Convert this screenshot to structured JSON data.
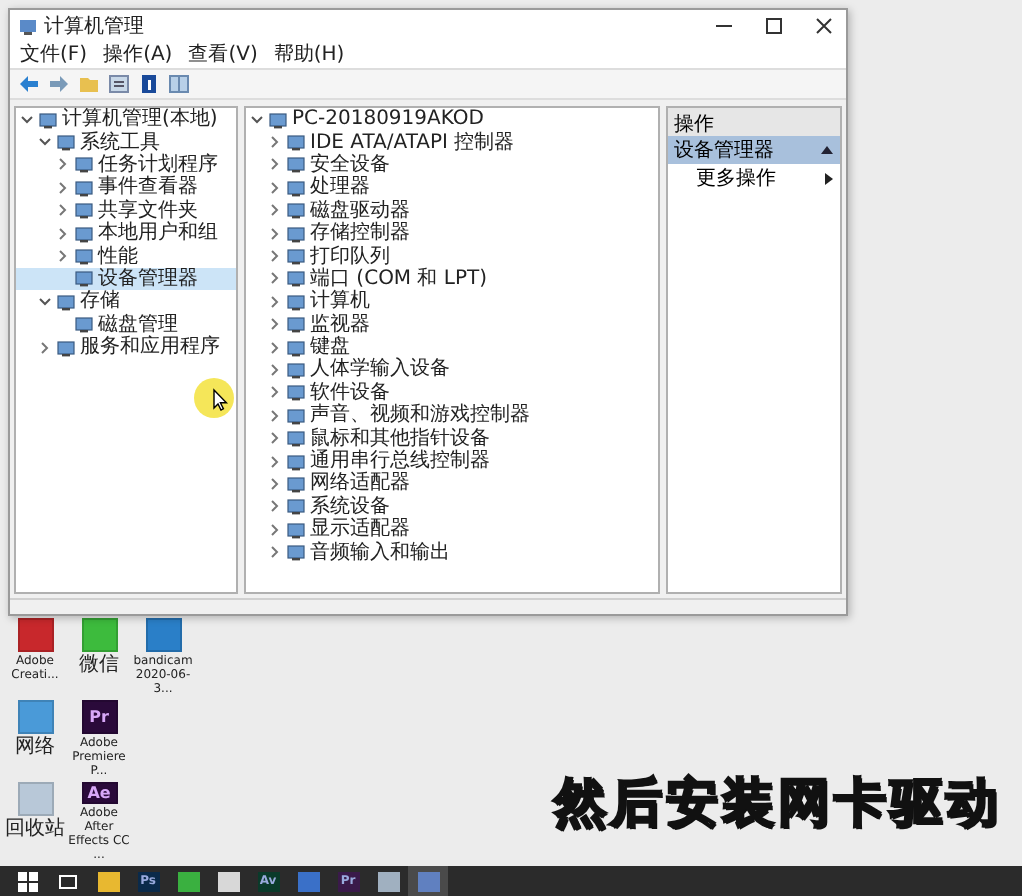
{
  "window": {
    "title": "计算机管理",
    "menu": [
      "文件(F)",
      "操作(A)",
      "查看(V)",
      "帮助(H)"
    ],
    "tree": [
      {
        "label": "计算机管理(本地)",
        "selected": false,
        "expanded": true,
        "children": [
          {
            "label": "系统工具",
            "selected": false,
            "expanded": true,
            "children": [
              {
                "label": "任务计划程序",
                "selected": false,
                "expanded": false
              },
              {
                "label": "事件查看器",
                "selected": false,
                "expanded": false
              },
              {
                "label": "共享文件夹",
                "selected": false,
                "expanded": false
              },
              {
                "label": "本地用户和组",
                "selected": false,
                "expanded": false
              },
              {
                "label": "性能",
                "selected": false,
                "expanded": false
              },
              {
                "label": "设备管理器",
                "selected": true
              }
            ]
          },
          {
            "label": "存储",
            "selected": false,
            "expanded": true,
            "children": [
              {
                "label": "磁盘管理",
                "selected": false
              }
            ]
          },
          {
            "label": "服务和应用程序",
            "selected": false,
            "expanded": false
          }
        ]
      }
    ],
    "devices": {
      "label": "PC-20180919AKOD",
      "expanded": true,
      "children": [
        {
          "label": "IDE ATA/ATAPI 控制器",
          "expanded": false
        },
        {
          "label": "安全设备",
          "expanded": false
        },
        {
          "label": "处理器",
          "expanded": false
        },
        {
          "label": "磁盘驱动器",
          "expanded": false
        },
        {
          "label": "存储控制器",
          "expanded": false
        },
        {
          "label": "打印队列",
          "expanded": false
        },
        {
          "label": "端口 (COM 和 LPT)",
          "expanded": false
        },
        {
          "label": "计算机",
          "expanded": false
        },
        {
          "label": "监视器",
          "expanded": false
        },
        {
          "label": "键盘",
          "expanded": false
        },
        {
          "label": "人体学输入设备",
          "expanded": false
        },
        {
          "label": "软件设备",
          "expanded": false
        },
        {
          "label": "声音、视频和游戏控制器",
          "expanded": false
        },
        {
          "label": "鼠标和其他指针设备",
          "expanded": false
        },
        {
          "label": "通用串行总线控制器",
          "expanded": false
        },
        {
          "label": "网络适配器",
          "expanded": false
        },
        {
          "label": "系统设备",
          "expanded": false
        },
        {
          "label": "显示适配器",
          "expanded": false
        },
        {
          "label": "音频输入和输出",
          "expanded": false
        }
      ]
    },
    "actions": {
      "header": "操作",
      "section": "设备管理器",
      "items": [
        "更多操作"
      ]
    }
  },
  "desktop_icons": [
    {
      "label": "Adobe Creati...",
      "kind": "creative"
    },
    {
      "label": "网络",
      "kind": "network"
    },
    {
      "label": "回收站",
      "kind": "recycle"
    },
    {
      "label": "微信",
      "kind": "chat"
    },
    {
      "label": "Adobe Premiere P...",
      "kind": "purple",
      "glyph": "Pr"
    },
    {
      "label": "Adobe After Effects CC ...",
      "kind": "purple",
      "glyph": "Ae"
    },
    {
      "label": "bandicam 2020-06-3...",
      "kind": "video"
    }
  ],
  "caption": "然后安装网卡驱动",
  "taskbar": [
    {
      "kind": "start"
    },
    {
      "kind": "taskview"
    },
    {
      "kind": "folder"
    },
    {
      "kind": "navy",
      "glyph": "Ps"
    },
    {
      "kind": "green"
    },
    {
      "kind": "mail"
    },
    {
      "kind": "teal",
      "glyph": "Av"
    },
    {
      "kind": "network"
    },
    {
      "kind": "purple",
      "glyph": "Pr"
    },
    {
      "kind": "file"
    },
    {
      "kind": "active"
    }
  ]
}
